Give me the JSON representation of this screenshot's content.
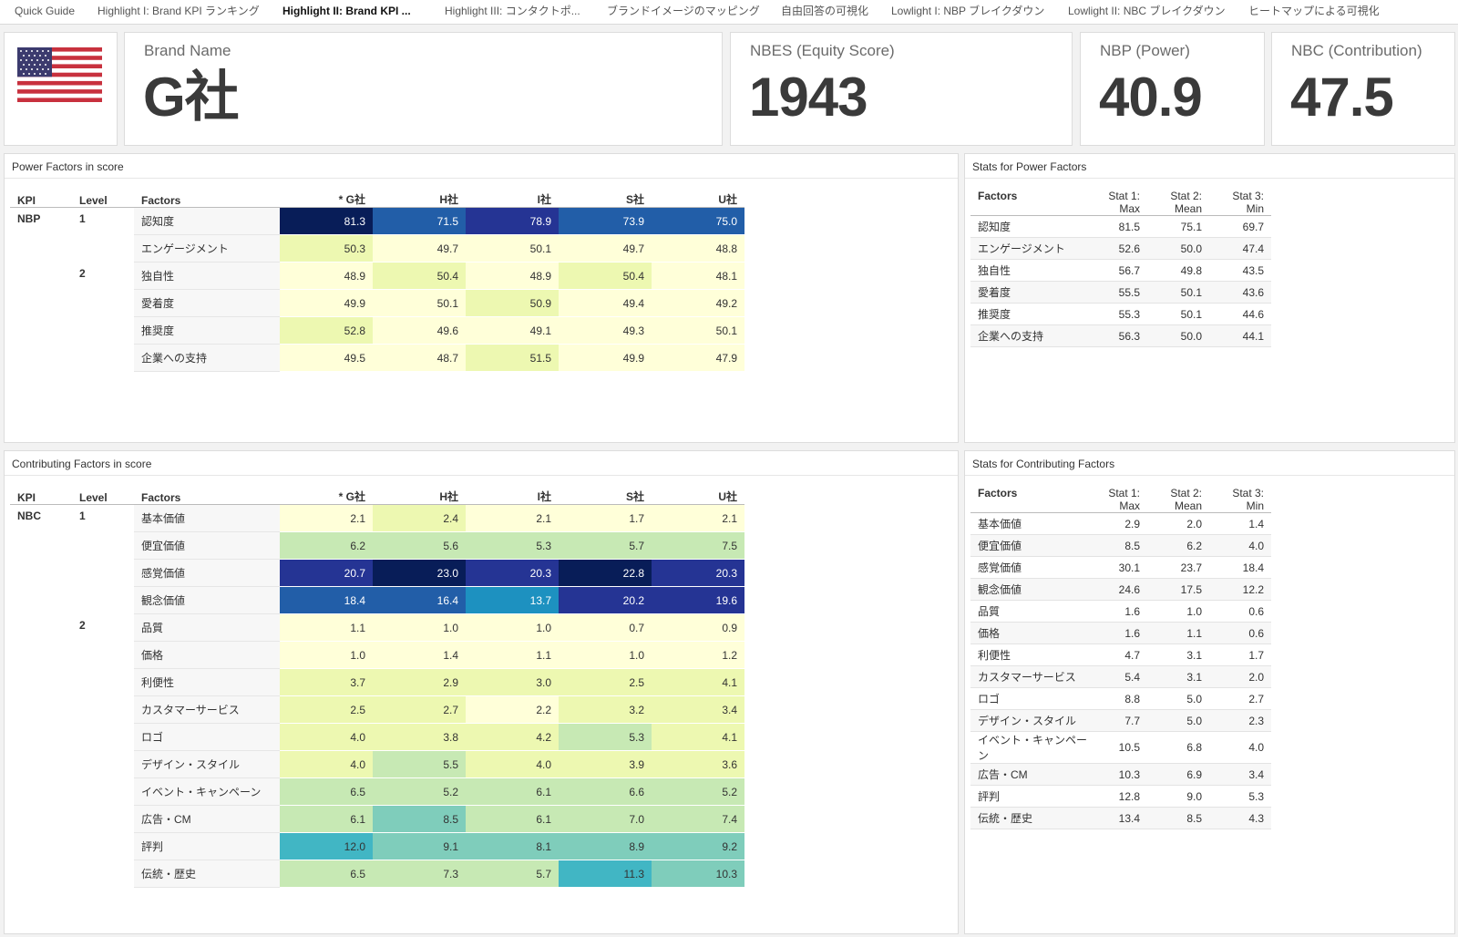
{
  "tabs": [
    {
      "label": "Quick Guide",
      "active": false
    },
    {
      "label": "Highlight I: Brand KPI ランキング",
      "active": false
    },
    {
      "label": "Highlight II: Brand KPI ...",
      "active": true
    },
    {
      "label": "Highlight III: コンタクトポ...",
      "active": false
    },
    {
      "label": "ブランドイメージのマッピング",
      "active": false
    },
    {
      "label": "自由回答の可視化",
      "active": false
    },
    {
      "label": "Lowlight I: NBP ブレイクダウン",
      "active": false
    },
    {
      "label": "Lowlight II: NBC ブレイクダウン",
      "active": false
    },
    {
      "label": "ヒートマップによる可視化",
      "active": false
    }
  ],
  "kpis": {
    "flag_icon": "us-flag-icon",
    "brand": {
      "label": "Brand Name",
      "value": "G社"
    },
    "nbes": {
      "label": "NBES (Equity Score)",
      "value": "1943"
    },
    "nbp": {
      "label": "NBP (Power)",
      "value": "40.9"
    },
    "nbc": {
      "label": "NBC (Contribution)",
      "value": "47.5"
    }
  },
  "power": {
    "title": "Power Factors in score",
    "headers": [
      "KPI",
      "Level",
      "Factors",
      "* G社",
      "H社",
      "I社",
      "S社",
      "U社"
    ],
    "kpi": "NBP",
    "rows": [
      {
        "level": "1",
        "factor": "認知度",
        "values": [
          "81.3",
          "71.5",
          "78.9",
          "73.9",
          "75.0"
        ]
      },
      {
        "level": "",
        "factor": "エンゲージメント",
        "values": [
          "50.3",
          "49.7",
          "50.1",
          "49.7",
          "48.8"
        ]
      },
      {
        "level": "2",
        "factor": "独自性",
        "values": [
          "48.9",
          "50.4",
          "48.9",
          "50.4",
          "48.1"
        ]
      },
      {
        "level": "",
        "factor": "愛着度",
        "values": [
          "49.9",
          "50.1",
          "50.9",
          "49.4",
          "49.2"
        ]
      },
      {
        "level": "",
        "factor": "推奨度",
        "values": [
          "52.8",
          "49.6",
          "49.1",
          "49.3",
          "50.1"
        ]
      },
      {
        "level": "",
        "factor": "企業への支持",
        "values": [
          "49.5",
          "48.7",
          "51.5",
          "49.9",
          "47.9"
        ]
      }
    ]
  },
  "power_stats": {
    "title": "Stats for Power Factors",
    "headers": {
      "factors": "Factors",
      "s1a": "Stat 1:",
      "s1b": "Max",
      "s2a": "Stat 2:",
      "s2b": "Mean",
      "s3a": "Stat 3:",
      "s3b": "Min"
    },
    "rows": [
      {
        "factor": "認知度",
        "max": "81.5",
        "mean": "75.1",
        "min": "69.7"
      },
      {
        "factor": "エンゲージメント",
        "max": "52.6",
        "mean": "50.0",
        "min": "47.4"
      },
      {
        "factor": "独自性",
        "max": "56.7",
        "mean": "49.8",
        "min": "43.5"
      },
      {
        "factor": "愛着度",
        "max": "55.5",
        "mean": "50.1",
        "min": "43.6"
      },
      {
        "factor": "推奨度",
        "max": "55.3",
        "mean": "50.1",
        "min": "44.6"
      },
      {
        "factor": "企業への支持",
        "max": "56.3",
        "mean": "50.0",
        "min": "44.1"
      }
    ]
  },
  "contrib": {
    "title": "Contributing Factors in score",
    "headers": [
      "KPI",
      "Level",
      "Factors",
      "* G社",
      "H社",
      "I社",
      "S社",
      "U社"
    ],
    "kpi": "NBC",
    "rows": [
      {
        "level": "1",
        "factor": "基本価値",
        "values": [
          "2.1",
          "2.4",
          "2.1",
          "1.7",
          "2.1"
        ]
      },
      {
        "level": "",
        "factor": "便宜価値",
        "values": [
          "6.2",
          "5.6",
          "5.3",
          "5.7",
          "7.5"
        ]
      },
      {
        "level": "",
        "factor": "感覚価値",
        "values": [
          "20.7",
          "23.0",
          "20.3",
          "22.8",
          "20.3"
        ]
      },
      {
        "level": "",
        "factor": "観念価値",
        "values": [
          "18.4",
          "16.4",
          "13.7",
          "20.2",
          "19.6"
        ]
      },
      {
        "level": "2",
        "factor": "品質",
        "values": [
          "1.1",
          "1.0",
          "1.0",
          "0.7",
          "0.9"
        ]
      },
      {
        "level": "",
        "factor": "価格",
        "values": [
          "1.0",
          "1.4",
          "1.1",
          "1.0",
          "1.2"
        ]
      },
      {
        "level": "",
        "factor": "利便性",
        "values": [
          "3.7",
          "2.9",
          "3.0",
          "2.5",
          "4.1"
        ]
      },
      {
        "level": "",
        "factor": "カスタマーサービス",
        "values": [
          "2.5",
          "2.7",
          "2.2",
          "3.2",
          "3.4"
        ]
      },
      {
        "level": "",
        "factor": "ロゴ",
        "values": [
          "4.0",
          "3.8",
          "4.2",
          "5.3",
          "4.1"
        ]
      },
      {
        "level": "",
        "factor": "デザイン・スタイル",
        "values": [
          "4.0",
          "5.5",
          "4.0",
          "3.9",
          "3.6"
        ]
      },
      {
        "level": "",
        "factor": "イベント・キャンペーン",
        "values": [
          "6.5",
          "5.2",
          "6.1",
          "6.6",
          "5.2"
        ]
      },
      {
        "level": "",
        "factor": "広告・CM",
        "values": [
          "6.1",
          "8.5",
          "6.1",
          "7.0",
          "7.4"
        ]
      },
      {
        "level": "",
        "factor": "評判",
        "values": [
          "12.0",
          "9.1",
          "8.1",
          "8.9",
          "9.2"
        ]
      },
      {
        "level": "",
        "factor": "伝統・歴史",
        "values": [
          "6.5",
          "7.3",
          "5.7",
          "11.3",
          "10.3"
        ]
      }
    ]
  },
  "contrib_stats": {
    "title": "Stats for Contributing Factors",
    "headers": {
      "factors": "Factors",
      "s1a": "Stat 1:",
      "s1b": "Max",
      "s2a": "Stat 2:",
      "s2b": "Mean",
      "s3a": "Stat 3:",
      "s3b": "Min"
    },
    "rows": [
      {
        "factor": "基本価値",
        "max": "2.9",
        "mean": "2.0",
        "min": "1.4"
      },
      {
        "factor": "便宜価値",
        "max": "8.5",
        "mean": "6.2",
        "min": "4.0"
      },
      {
        "factor": "感覚価値",
        "max": "30.1",
        "mean": "23.7",
        "min": "18.4"
      },
      {
        "factor": "観念価値",
        "max": "24.6",
        "mean": "17.5",
        "min": "12.2"
      },
      {
        "factor": "品質",
        "max": "1.6",
        "mean": "1.0",
        "min": "0.6"
      },
      {
        "factor": "価格",
        "max": "1.6",
        "mean": "1.1",
        "min": "0.6"
      },
      {
        "factor": "利便性",
        "max": "4.7",
        "mean": "3.1",
        "min": "1.7"
      },
      {
        "factor": "カスタマーサービス",
        "max": "5.4",
        "mean": "3.1",
        "min": "2.0"
      },
      {
        "factor": "ロゴ",
        "max": "8.8",
        "mean": "5.0",
        "min": "2.7"
      },
      {
        "factor": "デザイン・スタイル",
        "max": "7.7",
        "mean": "5.0",
        "min": "2.3"
      },
      {
        "factor": "イベント・キャンペーン",
        "max": "10.5",
        "mean": "6.8",
        "min": "4.0"
      },
      {
        "factor": "広告・CM",
        "max": "10.3",
        "mean": "6.9",
        "min": "3.4"
      },
      {
        "factor": "評判",
        "max": "12.8",
        "mean": "9.0",
        "min": "5.3"
      },
      {
        "factor": "伝統・歴史",
        "max": "13.4",
        "mean": "8.5",
        "min": "4.3"
      }
    ]
  },
  "colors": {
    "heat_scale": [
      "#ffffd9",
      "#edf8b1",
      "#c7e9b4",
      "#7fcdbb",
      "#41b6c4",
      "#1d91c0",
      "#225ea8",
      "#253494",
      "#081d58"
    ]
  }
}
